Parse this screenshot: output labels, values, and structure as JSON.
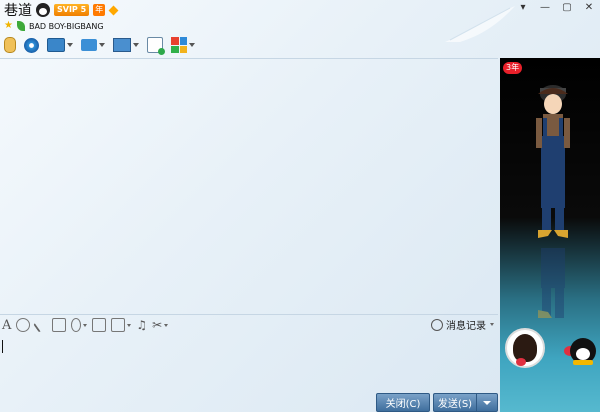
{
  "header": {
    "title": "巷道",
    "vip_label": "SVIP 5",
    "year_label": "年",
    "status_text": "BAD BOY-BIGBANG"
  },
  "window_controls": {
    "menu": "▾",
    "minimize": "—",
    "maximize": "▢",
    "close": "✕"
  },
  "toolbar": {
    "items": [
      {
        "icon": "microphone-icon"
      },
      {
        "icon": "video-camera-icon"
      },
      {
        "icon": "screen-share-icon"
      },
      {
        "icon": "file-transfer-icon"
      },
      {
        "icon": "remote-desktop-icon"
      },
      {
        "icon": "create-discussion-icon"
      },
      {
        "icon": "apps-icon"
      }
    ]
  },
  "input_toolbar": {
    "font_label": "A",
    "history_label": "消息记录"
  },
  "buttons": {
    "close_label": "关闭(C)",
    "send_label": "发送(S)"
  },
  "right_panel": {
    "year_tag": "3年"
  },
  "colors": {
    "accent": "#3f6e9d",
    "vip": "#f07f00",
    "panel_top": "#000000",
    "panel_bottom": "#56b9cf"
  }
}
